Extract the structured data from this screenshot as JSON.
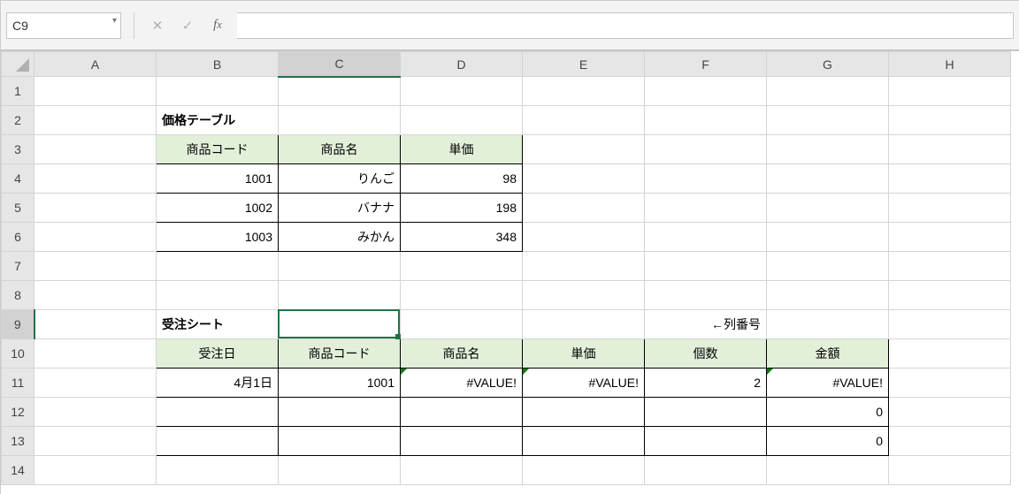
{
  "namebox": {
    "value": "C9"
  },
  "formula_bar": {
    "value": ""
  },
  "columns": [
    "A",
    "B",
    "C",
    "D",
    "E",
    "F",
    "G",
    "H"
  ],
  "row_count": 14,
  "selection": {
    "col": "C",
    "row": 9
  },
  "price_table": {
    "title": "価格テーブル",
    "headers": {
      "code": "商品コード",
      "name": "商品名",
      "price": "単価"
    },
    "rows": [
      {
        "code": "1001",
        "name": "りんご",
        "price": "98"
      },
      {
        "code": "1002",
        "name": "バナナ",
        "price": "198"
      },
      {
        "code": "1003",
        "name": "みかん",
        "price": "348"
      }
    ]
  },
  "order_sheet": {
    "title": "受注シート",
    "note": "←列番号",
    "headers": {
      "date": "受注日",
      "code": "商品コード",
      "name": "商品名",
      "price": "単価",
      "qty": "個数",
      "amount": "金額"
    },
    "rows": [
      {
        "date": "4月1日",
        "code": "1001",
        "name": "#VALUE!",
        "price": "#VALUE!",
        "qty": "2",
        "amount": "#VALUE!"
      },
      {
        "date": "",
        "code": "",
        "name": "",
        "price": "",
        "qty": "",
        "amount": "0"
      },
      {
        "date": "",
        "code": "",
        "name": "",
        "price": "",
        "qty": "",
        "amount": "0"
      }
    ]
  }
}
